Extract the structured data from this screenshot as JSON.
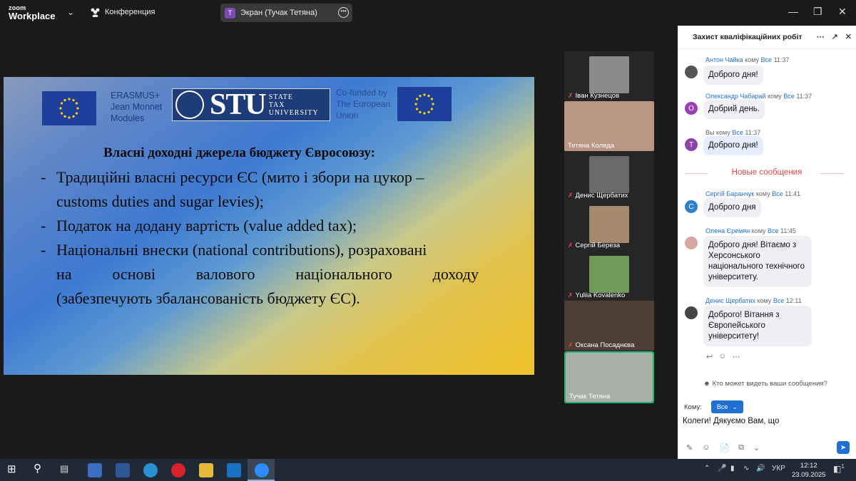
{
  "titlebar": {
    "logo_top": "zoom",
    "logo_bottom": "Workplace",
    "meeting_label": "Конференция",
    "screen_share_avatar": "T",
    "screen_share_label": "Экран (Тучак Тетяна)"
  },
  "slide": {
    "erasmus": [
      "ERASMUS+",
      "Jean Monnet",
      "Modules"
    ],
    "stu_big": "STU",
    "stu_small": [
      "STATE",
      "TAX",
      "UNIVERSITY"
    ],
    "cofunded": [
      "Co-funded by",
      "The European",
      "Union"
    ],
    "title": "Власні доходні джерела бюджету Євросоюзу:",
    "bullet1_line1": "Традиційні власні ресурси ЄС (мито і збори на цукор –",
    "bullet1_line2": "customs duties and sugar levies);",
    "bullet2": "Податок на додану вартість (value added tax);",
    "bullet3_line1": "Національні внески (national contributions), розраховані",
    "bullet3_line2_words": [
      "на",
      "основі",
      "валового",
      "національного",
      "доходу"
    ],
    "bullet3_line3": "(забезпечують збалансованість бюджету ЄС).",
    "dash": "-"
  },
  "participants": [
    {
      "name": "Іван Кузнецов",
      "muted": true,
      "color": "#8a8a8a"
    },
    {
      "name": "Тетяна Коляда",
      "muted": false,
      "color": "#b99684"
    },
    {
      "name": "Денис Щербатих",
      "muted": true,
      "color": "#6a6a6a"
    },
    {
      "name": "Сергій Береза",
      "muted": true,
      "color": "#a68a70"
    },
    {
      "name": "Yuliia Kovalenko",
      "muted": true,
      "color": "#6f9a5a"
    },
    {
      "name": "Оксана Посаднєва",
      "muted": true,
      "color": "#c99860"
    },
    {
      "name": "Тучак Тетяна",
      "muted": false,
      "color": "#a9b0a8"
    }
  ],
  "chat": {
    "title": "Захист кваліфікаційних робіт",
    "komu_word": "кому",
    "messages": [
      {
        "sender": "Антон Чайка",
        "to": "Все",
        "time": "11:37",
        "text": "Доброго дня!",
        "avatar": "",
        "avatar_color": "#555555"
      },
      {
        "sender": "Олександр Чабарай",
        "to": "Все",
        "time": "11:37",
        "text": "Добрий день.",
        "avatar": "O",
        "avatar_color": "#9b3fb5"
      },
      {
        "sender": "Вы",
        "to": "Все",
        "time": "11:37",
        "text": "Доброго дня!",
        "avatar": "T",
        "avatar_color": "#8b45a8"
      },
      {
        "sender": "Сергій Баранчук",
        "to": "Все",
        "time": "11:41",
        "text": "Доброго дня",
        "avatar": "C",
        "avatar_color": "#2d7fd0"
      },
      {
        "sender": "Олена Єремян",
        "to": "Все",
        "time": "11:45",
        "text": "Доброго дня! Вітаємо з Херсонського національного технічного університету.",
        "avatar": "",
        "avatar_color": "#d7a7a0"
      },
      {
        "sender": "Денис Щербатих",
        "to": "Все",
        "time": "12:11",
        "text": "Доброго! Вітання з Європейського університету!",
        "avatar": "",
        "avatar_color": "#444444"
      }
    ],
    "new_messages": "Новые сообщения",
    "who_can_see": "Кто может видеть ваши сообщения?",
    "to_label": "Кому:",
    "to_value": "Все",
    "input_value": "Колеги! Дякуємо Вам, що"
  },
  "taskbar": {
    "lang": "УКР",
    "time": "12:12",
    "date": "23.09.2025",
    "notif_count": "1"
  }
}
